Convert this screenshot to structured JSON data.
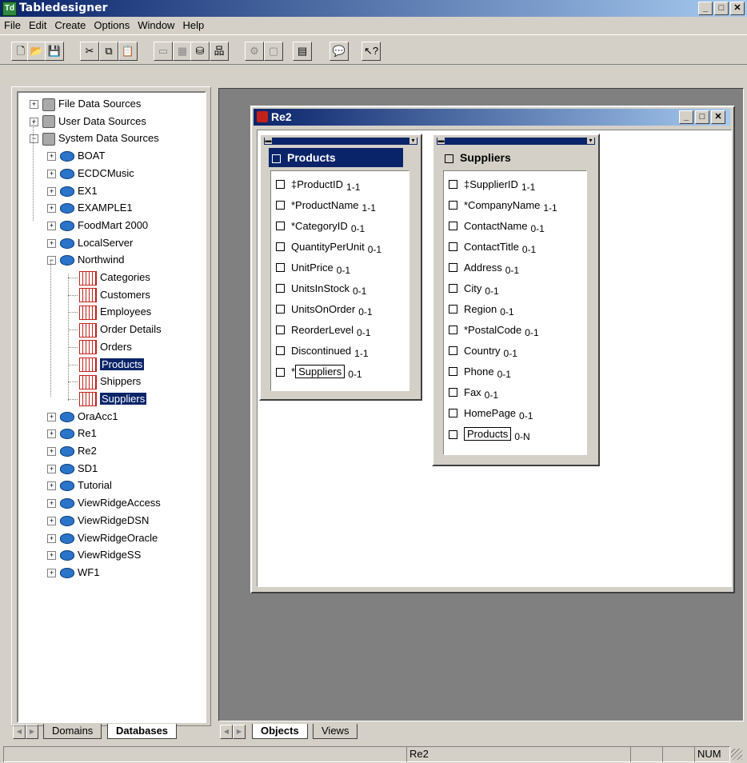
{
  "app": {
    "title": "Tabledesigner",
    "icon_label": "Td"
  },
  "menu": [
    "File",
    "Edit",
    "Create",
    "Options",
    "Window",
    "Help"
  ],
  "toolbar": [
    {
      "icon": "new-icon",
      "glyph": "🗋"
    },
    {
      "icon": "open-icon",
      "glyph": "📂"
    },
    {
      "icon": "save-icon",
      "glyph": "💾"
    },
    {
      "icon": "cut-icon",
      "glyph": "✂"
    },
    {
      "icon": "copy-icon",
      "glyph": "⧉"
    },
    {
      "icon": "paste-icon",
      "glyph": "📋"
    },
    {
      "icon": "window-icon",
      "glyph": "▭"
    },
    {
      "icon": "grid-icon",
      "glyph": "▦"
    },
    {
      "icon": "database-icon",
      "glyph": "⛁"
    },
    {
      "icon": "hierarchy-icon",
      "glyph": "品"
    },
    {
      "icon": "settings-icon",
      "glyph": "⚙"
    },
    {
      "icon": "layout-icon",
      "glyph": "▢"
    },
    {
      "icon": "table-icon",
      "glyph": "▤"
    },
    {
      "icon": "speech-icon",
      "glyph": "💬"
    },
    {
      "icon": "help-pointer-icon",
      "glyph": "↖?"
    }
  ],
  "tree": {
    "roots": [
      "File Data Sources",
      "User Data Sources",
      "System Data Sources"
    ],
    "databases": [
      "BOAT",
      "ECDCMusic",
      "EX1",
      "EXAMPLE1",
      "FoodMart 2000",
      "LocalServer",
      "Northwind"
    ],
    "northwind_tables": [
      "Categories",
      "Customers",
      "Employees",
      "Order Details",
      "Orders",
      "Products",
      "Shippers",
      "Suppliers"
    ],
    "selected_tables": [
      "Products",
      "Suppliers"
    ],
    "databases_after": [
      "OraAcc1",
      "Re1",
      "Re2",
      "SD1",
      "Tutorial",
      "ViewRidgeAccess",
      "ViewRidgeDSN",
      "ViewRidgeOracle",
      "ViewRidgeSS",
      "WF1"
    ]
  },
  "child_window": {
    "title": "Re2"
  },
  "products": {
    "name": "Products",
    "attributes": [
      {
        "name": "‡ProductID",
        "card": "1-1"
      },
      {
        "name": "*ProductName",
        "card": "1-1"
      },
      {
        "name": "*CategoryID",
        "card": "0-1"
      },
      {
        "name": "QuantityPerUnit",
        "card": "0-1"
      },
      {
        "name": "UnitPrice",
        "card": "0-1"
      },
      {
        "name": "UnitsInStock",
        "card": "0-1"
      },
      {
        "name": "UnitsOnOrder",
        "card": "0-1"
      },
      {
        "name": "ReorderLevel",
        "card": "0-1"
      },
      {
        "name": "Discontinued",
        "card": "1-1"
      }
    ],
    "ref": {
      "prefix": "*",
      "name": "Suppliers",
      "card": "0-1"
    }
  },
  "suppliers": {
    "name": "Suppliers",
    "attributes": [
      {
        "name": "‡SupplierID",
        "card": "1-1"
      },
      {
        "name": "*CompanyName",
        "card": "1-1"
      },
      {
        "name": "ContactName",
        "card": "0-1"
      },
      {
        "name": "ContactTitle",
        "card": "0-1"
      },
      {
        "name": "Address",
        "card": "0-1"
      },
      {
        "name": "City",
        "card": "0-1"
      },
      {
        "name": "Region",
        "card": "0-1"
      },
      {
        "name": "*PostalCode",
        "card": "0-1"
      },
      {
        "name": "Country",
        "card": "0-1"
      },
      {
        "name": "Phone",
        "card": "0-1"
      },
      {
        "name": "Fax",
        "card": "0-1"
      },
      {
        "name": "HomePage",
        "card": "0-1"
      }
    ],
    "ref": {
      "prefix": "",
      "name": "Products",
      "card": "0-N"
    }
  },
  "left_tabs": {
    "domains": "Domains",
    "databases": "Databases",
    "active": "Databases"
  },
  "right_tabs": {
    "objects": "Objects",
    "views": "Views",
    "active": "Objects"
  },
  "status": {
    "center": "Re2",
    "num": "NUM"
  }
}
